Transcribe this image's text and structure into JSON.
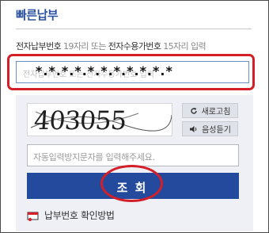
{
  "header": {
    "title": "빠른납부"
  },
  "instruction": {
    "text_dark_1": "전자납부번호",
    "text_dim_1": " 19자리 또는 ",
    "text_dark_2": "전자수용가번호",
    "text_dim_2": " 15자리 입력"
  },
  "payment_number_input": {
    "placeholder": "전자납부번호 또는 전자수용가번호 입력",
    "masked_value": "*.*.*.*.*.*.*.*.*.*.*"
  },
  "captcha": {
    "code": "403055",
    "refresh_label": "새로고침",
    "audio_label": "음성듣기"
  },
  "autofill_input": {
    "placeholder": "자동입력방지문자를 입력해주세요."
  },
  "submit": {
    "label": "조 회"
  },
  "help": {
    "label": "납부번호 확인방법"
  },
  "colors": {
    "accent": "#234a9c",
    "highlight": "#d41f28"
  },
  "icons": [
    "refresh-icon",
    "speaker-icon",
    "bill-icon"
  ]
}
